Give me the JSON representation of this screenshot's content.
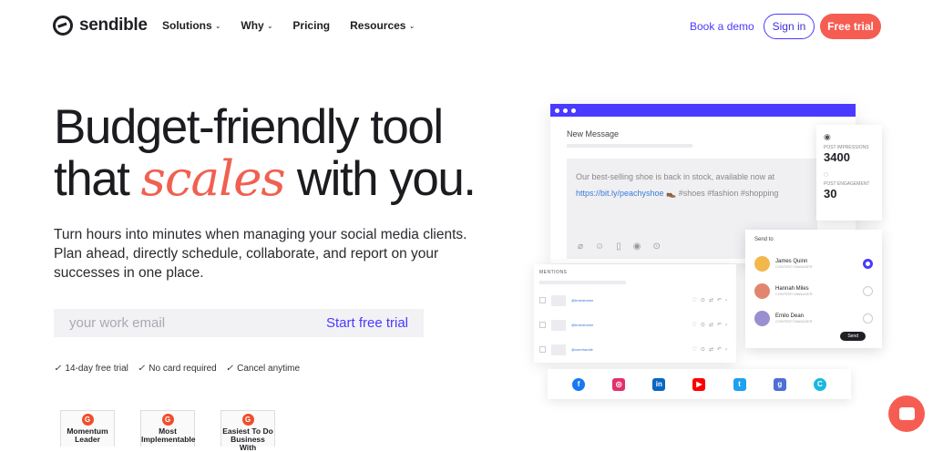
{
  "nav": {
    "brand": "sendible",
    "menu": [
      {
        "label": "Solutions",
        "has_dropdown": true
      },
      {
        "label": "Why",
        "has_dropdown": true
      },
      {
        "label": "Pricing",
        "has_dropdown": false
      },
      {
        "label": "Resources",
        "has_dropdown": true
      }
    ],
    "book_demo": "Book a demo",
    "sign_in": "Sign in",
    "free_trial": "Free trial"
  },
  "hero": {
    "line1": "Budget-friendly tool",
    "line2_pre": "that ",
    "line2_em": "scales",
    "line2_post": " with you.",
    "subtitle": "Turn hours into minutes when managing your social media clients. Plan ahead, directly schedule, collaborate, and report on your successes in one place."
  },
  "signup": {
    "email_placeholder": "your work email",
    "cta": "Start free trial"
  },
  "perks": [
    "14-day free trial",
    "No card required",
    "Cancel anytime"
  ],
  "badges": [
    {
      "label": "Momentum Leader"
    },
    {
      "label": "Most Implementable"
    },
    {
      "label": "Easiest To Do Business With"
    }
  ],
  "mockup": {
    "compose_title": "New Message",
    "message_text": "Our best-selling shoe is back in stock, available now at",
    "message_link": "https://bit.ly/peachyshoe",
    "message_tags": " 👞 #shoes #fashion #shopping",
    "stats": [
      {
        "label": "POST IMPRESSIONS",
        "value": "3400",
        "icon": "eye-icon"
      },
      {
        "label": "POST ENGAGEMENT",
        "value": "30",
        "icon": "chat-icon"
      }
    ],
    "send_to_title": "Send to",
    "people": [
      {
        "name": "James Quinn",
        "role": "CONTENT MANAGER",
        "selected": true,
        "avatar_color": "#f2b84b"
      },
      {
        "name": "Hannah Miles",
        "role": "CONTENT MANAGER",
        "selected": false,
        "avatar_color": "#e2856f"
      },
      {
        "name": "Emilo Dean",
        "role": "CONTENT MANAGER",
        "selected": false,
        "avatar_color": "#9a8fd0"
      }
    ],
    "send_button": "Send",
    "mentions_title": "MENTIONS",
    "mention_handles": [
      "@brandname",
      "@brandname",
      "@userhandle"
    ],
    "social_networks": [
      {
        "name": "facebook-icon",
        "color": "#1877f2",
        "glyph": "f"
      },
      {
        "name": "instagram-icon",
        "color": "#e1306c",
        "glyph": "◎"
      },
      {
        "name": "linkedin-icon",
        "color": "#0a66c2",
        "glyph": "in"
      },
      {
        "name": "youtube-icon",
        "color": "#ff0000",
        "glyph": "▶"
      },
      {
        "name": "twitter-icon",
        "color": "#1da1f2",
        "glyph": "t"
      },
      {
        "name": "google-business-icon",
        "color": "#4c6fd8",
        "glyph": "g"
      },
      {
        "name": "canva-icon",
        "color": "#19b8e0",
        "glyph": "C"
      }
    ]
  },
  "colors": {
    "accent": "#4a3aff",
    "coral": "#f65d52"
  }
}
